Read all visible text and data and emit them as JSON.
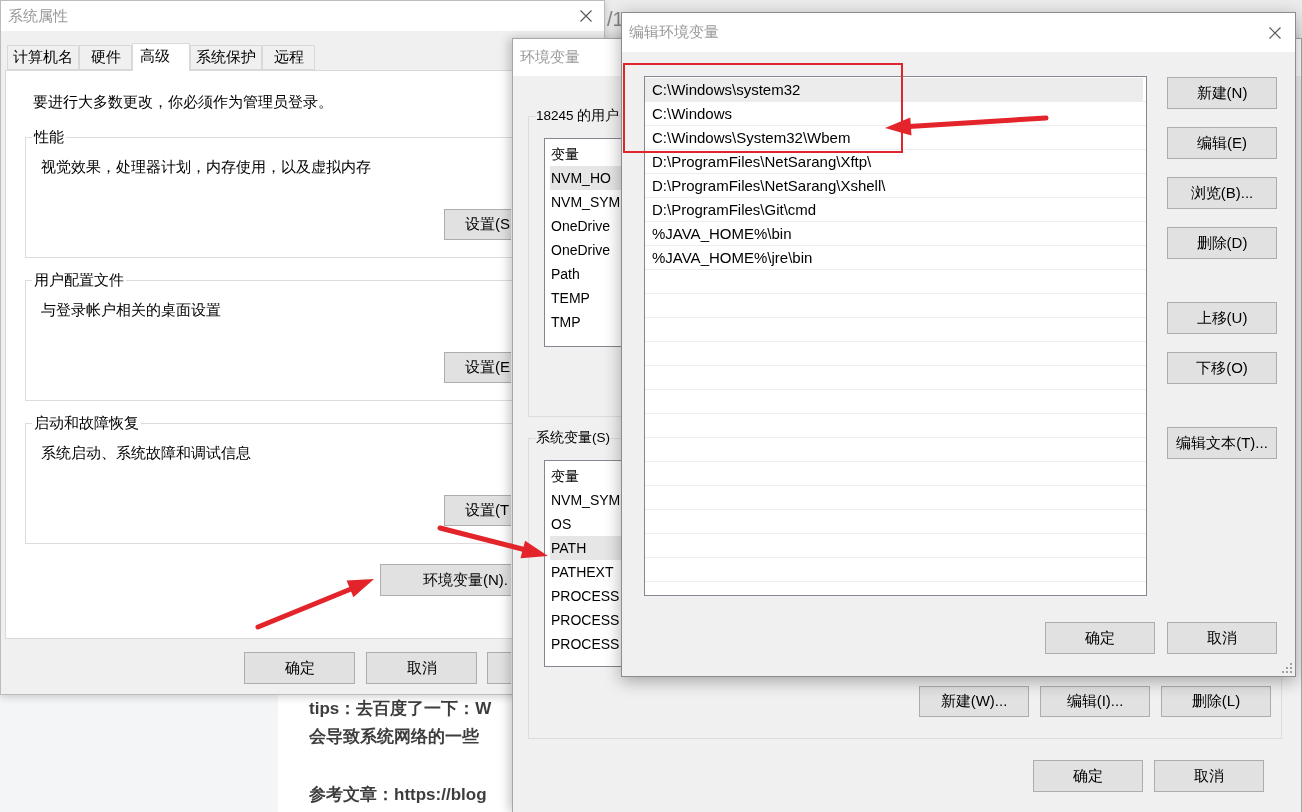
{
  "background_page": {
    "header_fragment": "/1",
    "paragraphs": [
      [
        "tips：去百度了一下：W",
        "会导致系统网络的一些"
      ],
      [
        "参考文章：https://blog"
      ]
    ]
  },
  "system_properties": {
    "title": "系统属性",
    "tabs": [
      {
        "label": "计算机名",
        "selected": false
      },
      {
        "label": "硬件",
        "selected": false
      },
      {
        "label": "高级",
        "selected": true
      },
      {
        "label": "系统保护",
        "selected": false
      },
      {
        "label": "远程",
        "selected": false
      }
    ],
    "notice": "要进行大多数更改，你必须作为管理员登录。",
    "groups": [
      {
        "title": "性能",
        "description": "视觉效果，处理器计划，内存使用，以及虚拟内存",
        "button": "设置(S"
      },
      {
        "title": "用户配置文件",
        "description": "与登录帐户相关的桌面设置",
        "button": "设置(E"
      },
      {
        "title": "启动和故障恢复",
        "description": "系统启动、系统故障和调试信息",
        "button": "设置(T"
      }
    ],
    "environment_button": "环境变量(N).",
    "buttons": [
      "确定",
      "取消"
    ]
  },
  "environment_variables": {
    "title": "环境变量",
    "user_variables": {
      "title": "18245 的用户",
      "column": "变量",
      "rows": [
        {
          "name": "NVM_HO",
          "selected": true
        },
        {
          "name": "NVM_SYM",
          "selected": false
        },
        {
          "name": "OneDrive",
          "selected": false
        },
        {
          "name": "OneDrive",
          "selected": false
        },
        {
          "name": "Path",
          "selected": false
        },
        {
          "name": "TEMP",
          "selected": false
        },
        {
          "name": "TMP",
          "selected": false
        }
      ]
    },
    "system_variables": {
      "title": "系统变量(S)",
      "column": "变量",
      "rows": [
        {
          "name": "NVM_SYM",
          "selected": false
        },
        {
          "name": "OS",
          "selected": false
        },
        {
          "name": "PATH",
          "selected": true
        },
        {
          "name": "PATHEXT",
          "selected": false
        },
        {
          "name": "PROCESS",
          "selected": false
        },
        {
          "name": "PROCESS",
          "selected": false
        },
        {
          "name": "PROCESS",
          "selected": false
        }
      ],
      "buttons": [
        "新建(W)...",
        "编辑(I)...",
        "删除(L)"
      ]
    },
    "buttons": [
      "确定",
      "取消"
    ]
  },
  "edit_environment_variable": {
    "title": "编辑环境变量",
    "entries": [
      {
        "text": "C:\\Windows\\system32",
        "selected": true
      },
      {
        "text": "C:\\Windows",
        "selected": false
      },
      {
        "text": "C:\\Windows\\System32\\Wbem",
        "selected": false
      },
      {
        "text": "D:\\ProgramFiles\\NetSarang\\Xftp\\",
        "selected": false
      },
      {
        "text": "D:\\ProgramFiles\\NetSarang\\Xshell\\",
        "selected": false
      },
      {
        "text": "D:\\ProgramFiles\\Git\\cmd",
        "selected": false
      },
      {
        "text": "%JAVA_HOME%\\bin",
        "selected": false
      },
      {
        "text": "%JAVA_HOME%\\jre\\bin",
        "selected": false
      }
    ],
    "button_groups": [
      [
        "新建(N)",
        "编辑(E)",
        "浏览(B)...",
        "删除(D)"
      ],
      [
        "上移(U)",
        "下移(O)"
      ],
      [
        "编辑文本(T)..."
      ]
    ],
    "buttons": [
      "确定",
      "取消"
    ]
  }
}
